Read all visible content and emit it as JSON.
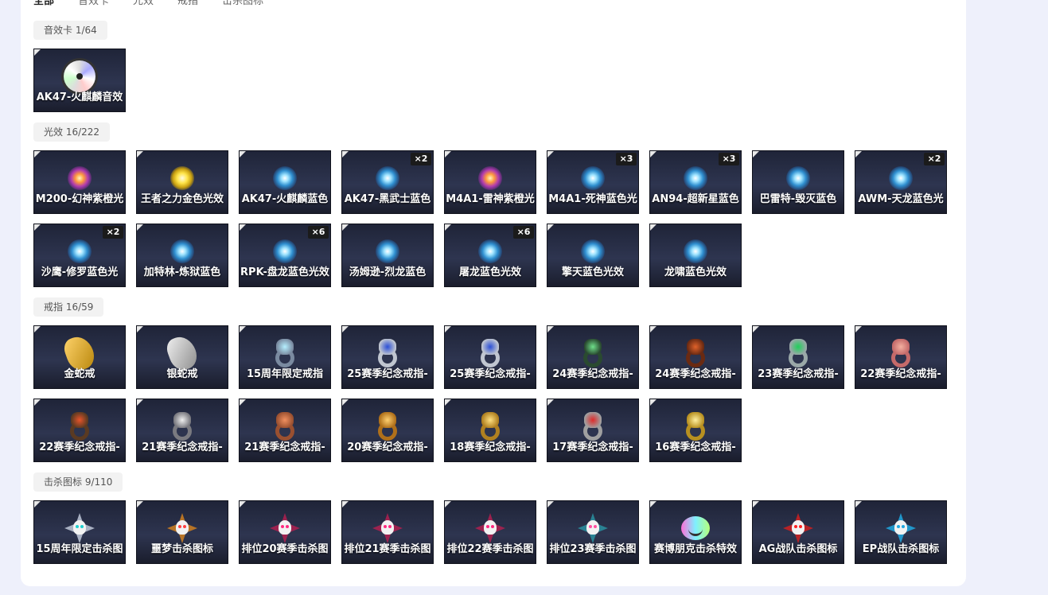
{
  "tabs": [
    {
      "label": "全部",
      "active": true
    },
    {
      "label": "音效卡",
      "active": false
    },
    {
      "label": "光效",
      "active": false
    },
    {
      "label": "戒指",
      "active": false
    },
    {
      "label": "击杀图标",
      "active": false
    }
  ],
  "sections": {
    "sound": {
      "label": "音效卡 1/64",
      "items": [
        {
          "name": "AK47-火麒麟音效",
          "icon": "disc-icon"
        }
      ]
    },
    "light": {
      "label": "光效 16/222",
      "items": [
        {
          "name": "M200-幻神紫橙光",
          "badge": "",
          "icon": "purple-glow-icon"
        },
        {
          "name": "王者之力金色光效",
          "badge": "",
          "icon": "gold-glow-icon"
        },
        {
          "name": "AK47-火麒麟蓝色",
          "badge": "",
          "icon": "blue-glow-icon"
        },
        {
          "name": "AK47-黑武士蓝色",
          "badge": "×2",
          "icon": "blue-glow-icon"
        },
        {
          "name": "M4A1-雷神紫橙光",
          "badge": "",
          "icon": "purple-glow-icon"
        },
        {
          "name": "M4A1-死神蓝色光",
          "badge": "×3",
          "icon": "blue-glow-icon"
        },
        {
          "name": "AN94-超新星蓝色",
          "badge": "×3",
          "icon": "blue-glow-icon"
        },
        {
          "name": "巴雷特-毁灭蓝色",
          "badge": "",
          "icon": "blue-glow-icon"
        },
        {
          "name": "AWM-天龙蓝色光",
          "badge": "×2",
          "icon": "blue-glow-icon"
        },
        {
          "name": "沙鹰-修罗蓝色光",
          "badge": "×2",
          "icon": "blue-glow-icon"
        },
        {
          "name": "加特林-炼狱蓝色",
          "badge": "",
          "icon": "blue-glow-icon"
        },
        {
          "name": "RPK-盘龙蓝色光效",
          "badge": "×6",
          "icon": "blue-glow-icon"
        },
        {
          "name": "汤姆逊-烈龙蓝色",
          "badge": "",
          "icon": "blue-glow-icon"
        },
        {
          "name": "屠龙蓝色光效",
          "badge": "×6",
          "icon": "blue-glow-icon"
        },
        {
          "name": "擎天蓝色光效",
          "badge": "",
          "icon": "blue-glow-icon"
        },
        {
          "name": "龙啸蓝色光效",
          "badge": "",
          "icon": "blue-glow-icon"
        }
      ]
    },
    "rings": {
      "label": "戒指 16/59",
      "items": [
        {
          "name": "金蛇戒",
          "icon": "gold-snake-ring-icon",
          "c1": "#b8860b",
          "c2": "#ffd36b"
        },
        {
          "name": "银蛇戒",
          "icon": "silver-snake-ring-icon",
          "c1": "#8c8c8c",
          "c2": "#f0f0f0"
        },
        {
          "name": "15周年限定戒指",
          "icon": "anniversary-ring-icon",
          "c1": "#7a8aa0",
          "c2": "#b5f0ff"
        },
        {
          "name": "25赛季纪念戒指-",
          "icon": "season-ring-icon",
          "c1": "#c0c6d0",
          "c2": "#2b4fd6"
        },
        {
          "name": "25赛季纪念戒指-",
          "icon": "season-ring-icon",
          "c1": "#c0c6d0",
          "c2": "#2b4fd6"
        },
        {
          "name": "24赛季纪念戒指-",
          "icon": "season-ring-icon",
          "c1": "#2a4a30",
          "c2": "#6fe08a"
        },
        {
          "name": "24赛季纪念戒指-",
          "icon": "season-ring-icon",
          "c1": "#6a2a12",
          "c2": "#e0622a"
        },
        {
          "name": "23赛季纪念戒指-",
          "icon": "season-ring-icon",
          "c1": "#9aa8a8",
          "c2": "#1fd05a"
        },
        {
          "name": "22赛季纪念戒指-",
          "icon": "season-ring-icon",
          "c1": "#c46a6a",
          "c2": "#f4b0a0"
        },
        {
          "name": "22赛季纪念戒指-",
          "icon": "season-ring-icon",
          "c1": "#5a3a22",
          "c2": "#e8542a"
        },
        {
          "name": "21赛季纪念戒指-",
          "icon": "season-ring-icon",
          "c1": "#7a7a80",
          "c2": "#f0f0f0"
        },
        {
          "name": "21赛季纪念戒指-",
          "icon": "season-ring-icon",
          "c1": "#9a5030",
          "c2": "#f09060"
        },
        {
          "name": "20赛季纪念戒指-",
          "icon": "season-ring-icon",
          "c1": "#b0701a",
          "c2": "#ffd070"
        },
        {
          "name": "18赛季纪念戒指-",
          "icon": "season-ring-icon",
          "c1": "#b08020",
          "c2": "#ffe080"
        },
        {
          "name": "17赛季纪念戒指-",
          "icon": "season-ring-icon",
          "c1": "#a0a0a0",
          "c2": "#e02a2a"
        },
        {
          "name": "16赛季纪念戒指-",
          "icon": "season-ring-icon",
          "c1": "#b89020",
          "c2": "#fff0a0"
        }
      ]
    },
    "kill": {
      "label": "击杀图标 9/110",
      "items": [
        {
          "name": "15周年限定击杀图",
          "icon": "skull-kill-icon",
          "c1": "#c0c8d8",
          "c2": "#20d0d0"
        },
        {
          "name": "噩梦击杀图标",
          "icon": "nightmare-kill-icon",
          "c1": "#d08020",
          "c2": "#ff4040"
        },
        {
          "name": "排位20赛季击杀图",
          "icon": "skull-kill-icon",
          "c1": "#b02050",
          "c2": "#ff2a80"
        },
        {
          "name": "排位21赛季击杀图",
          "icon": "skull-kill-icon",
          "c1": "#b02050",
          "c2": "#ff2a80"
        },
        {
          "name": "排位22赛季击杀图",
          "icon": "skull-kill-icon",
          "c1": "#b02050",
          "c2": "#ff2a80"
        },
        {
          "name": "排位23赛季击杀图",
          "icon": "skull-kill-icon",
          "c1": "#2a90a0",
          "c2": "#ff4fa0"
        },
        {
          "name": "赛博朋克击杀特效",
          "icon": "cyberpunk-smiley-icon",
          "c1": "#ff6fd8",
          "c2": "#7ef0ff"
        },
        {
          "name": "AG战队击杀图标",
          "icon": "ag-team-skull-icon",
          "c1": "#d02020",
          "c2": "#ff2020"
        },
        {
          "name": "EP战队击杀图标",
          "icon": "ep-team-skull-icon",
          "c1": "#20a8e0",
          "c2": "#20a8e0"
        }
      ]
    }
  }
}
